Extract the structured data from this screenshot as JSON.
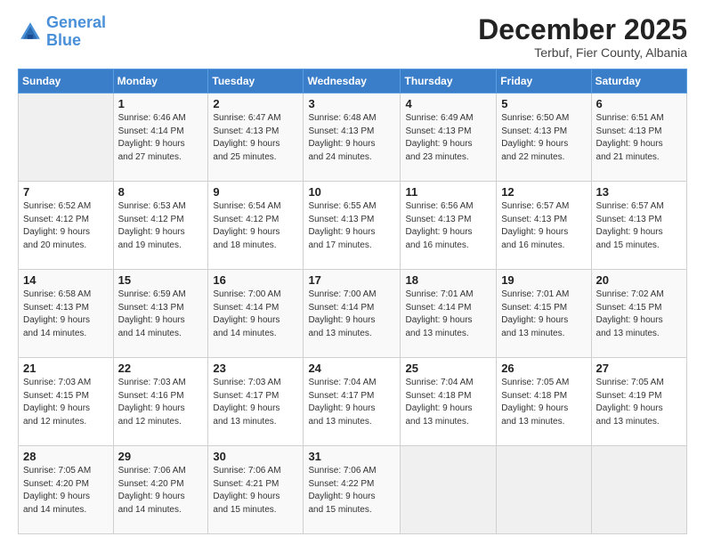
{
  "header": {
    "logo_line1": "General",
    "logo_line2": "Blue",
    "month_title": "December 2025",
    "subtitle": "Terbuf, Fier County, Albania"
  },
  "weekdays": [
    "Sunday",
    "Monday",
    "Tuesday",
    "Wednesday",
    "Thursday",
    "Friday",
    "Saturday"
  ],
  "weeks": [
    [
      {
        "day": "",
        "info": ""
      },
      {
        "day": "1",
        "info": "Sunrise: 6:46 AM\nSunset: 4:14 PM\nDaylight: 9 hours\nand 27 minutes."
      },
      {
        "day": "2",
        "info": "Sunrise: 6:47 AM\nSunset: 4:13 PM\nDaylight: 9 hours\nand 25 minutes."
      },
      {
        "day": "3",
        "info": "Sunrise: 6:48 AM\nSunset: 4:13 PM\nDaylight: 9 hours\nand 24 minutes."
      },
      {
        "day": "4",
        "info": "Sunrise: 6:49 AM\nSunset: 4:13 PM\nDaylight: 9 hours\nand 23 minutes."
      },
      {
        "day": "5",
        "info": "Sunrise: 6:50 AM\nSunset: 4:13 PM\nDaylight: 9 hours\nand 22 minutes."
      },
      {
        "day": "6",
        "info": "Sunrise: 6:51 AM\nSunset: 4:13 PM\nDaylight: 9 hours\nand 21 minutes."
      }
    ],
    [
      {
        "day": "7",
        "info": "Sunrise: 6:52 AM\nSunset: 4:12 PM\nDaylight: 9 hours\nand 20 minutes."
      },
      {
        "day": "8",
        "info": "Sunrise: 6:53 AM\nSunset: 4:12 PM\nDaylight: 9 hours\nand 19 minutes."
      },
      {
        "day": "9",
        "info": "Sunrise: 6:54 AM\nSunset: 4:12 PM\nDaylight: 9 hours\nand 18 minutes."
      },
      {
        "day": "10",
        "info": "Sunrise: 6:55 AM\nSunset: 4:13 PM\nDaylight: 9 hours\nand 17 minutes."
      },
      {
        "day": "11",
        "info": "Sunrise: 6:56 AM\nSunset: 4:13 PM\nDaylight: 9 hours\nand 16 minutes."
      },
      {
        "day": "12",
        "info": "Sunrise: 6:57 AM\nSunset: 4:13 PM\nDaylight: 9 hours\nand 16 minutes."
      },
      {
        "day": "13",
        "info": "Sunrise: 6:57 AM\nSunset: 4:13 PM\nDaylight: 9 hours\nand 15 minutes."
      }
    ],
    [
      {
        "day": "14",
        "info": "Sunrise: 6:58 AM\nSunset: 4:13 PM\nDaylight: 9 hours\nand 14 minutes."
      },
      {
        "day": "15",
        "info": "Sunrise: 6:59 AM\nSunset: 4:13 PM\nDaylight: 9 hours\nand 14 minutes."
      },
      {
        "day": "16",
        "info": "Sunrise: 7:00 AM\nSunset: 4:14 PM\nDaylight: 9 hours\nand 14 minutes."
      },
      {
        "day": "17",
        "info": "Sunrise: 7:00 AM\nSunset: 4:14 PM\nDaylight: 9 hours\nand 13 minutes."
      },
      {
        "day": "18",
        "info": "Sunrise: 7:01 AM\nSunset: 4:14 PM\nDaylight: 9 hours\nand 13 minutes."
      },
      {
        "day": "19",
        "info": "Sunrise: 7:01 AM\nSunset: 4:15 PM\nDaylight: 9 hours\nand 13 minutes."
      },
      {
        "day": "20",
        "info": "Sunrise: 7:02 AM\nSunset: 4:15 PM\nDaylight: 9 hours\nand 13 minutes."
      }
    ],
    [
      {
        "day": "21",
        "info": "Sunrise: 7:03 AM\nSunset: 4:15 PM\nDaylight: 9 hours\nand 12 minutes."
      },
      {
        "day": "22",
        "info": "Sunrise: 7:03 AM\nSunset: 4:16 PM\nDaylight: 9 hours\nand 12 minutes."
      },
      {
        "day": "23",
        "info": "Sunrise: 7:03 AM\nSunset: 4:17 PM\nDaylight: 9 hours\nand 13 minutes."
      },
      {
        "day": "24",
        "info": "Sunrise: 7:04 AM\nSunset: 4:17 PM\nDaylight: 9 hours\nand 13 minutes."
      },
      {
        "day": "25",
        "info": "Sunrise: 7:04 AM\nSunset: 4:18 PM\nDaylight: 9 hours\nand 13 minutes."
      },
      {
        "day": "26",
        "info": "Sunrise: 7:05 AM\nSunset: 4:18 PM\nDaylight: 9 hours\nand 13 minutes."
      },
      {
        "day": "27",
        "info": "Sunrise: 7:05 AM\nSunset: 4:19 PM\nDaylight: 9 hours\nand 13 minutes."
      }
    ],
    [
      {
        "day": "28",
        "info": "Sunrise: 7:05 AM\nSunset: 4:20 PM\nDaylight: 9 hours\nand 14 minutes."
      },
      {
        "day": "29",
        "info": "Sunrise: 7:06 AM\nSunset: 4:20 PM\nDaylight: 9 hours\nand 14 minutes."
      },
      {
        "day": "30",
        "info": "Sunrise: 7:06 AM\nSunset: 4:21 PM\nDaylight: 9 hours\nand 15 minutes."
      },
      {
        "day": "31",
        "info": "Sunrise: 7:06 AM\nSunset: 4:22 PM\nDaylight: 9 hours\nand 15 minutes."
      },
      {
        "day": "",
        "info": ""
      },
      {
        "day": "",
        "info": ""
      },
      {
        "day": "",
        "info": ""
      }
    ]
  ]
}
